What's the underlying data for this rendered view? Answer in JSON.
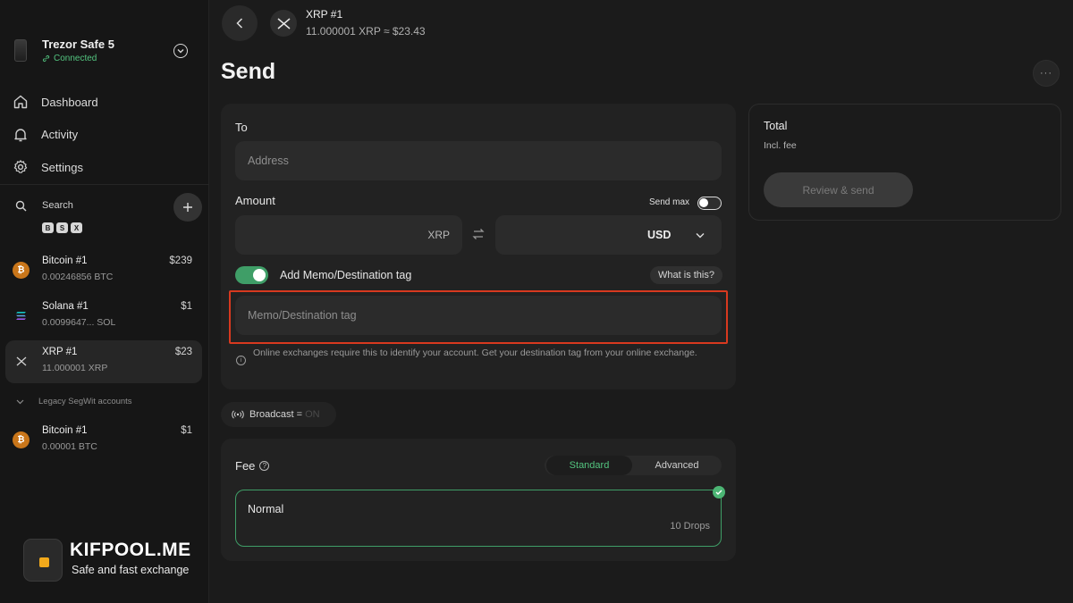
{
  "device": {
    "name": "Trezor Safe 5",
    "status": "Connected"
  },
  "nav": [
    {
      "label": "Dashboard",
      "icon": "home-icon"
    },
    {
      "label": "Activity",
      "icon": "bell-icon"
    },
    {
      "label": "Settings",
      "icon": "gear-icon"
    }
  ],
  "search": {
    "label": "Search"
  },
  "coin_filters": [
    "B",
    "S",
    "X"
  ],
  "accounts": [
    {
      "name": "Bitcoin #1",
      "balance": "0.00246856 BTC",
      "fiat": "$239",
      "icon": "bitcoin-icon",
      "color": "#f7931a"
    },
    {
      "name": "Solana #1",
      "balance": "0.0099647... SOL",
      "fiat": "$1",
      "icon": "solana-icon",
      "color": "#14f195"
    },
    {
      "name": "XRP #1",
      "balance": "11.000001 XRP",
      "fiat": "$23",
      "icon": "xrp-icon",
      "color": "#2e2e2e"
    }
  ],
  "legacy": {
    "label": "Legacy SegWit accounts",
    "accounts": [
      {
        "name": "Bitcoin #1",
        "balance": "0.00001 BTC",
        "fiat": "$1",
        "icon": "bitcoin-icon",
        "color": "#f7931a"
      }
    ]
  },
  "brand": {
    "title": "KIFPOOL.ME",
    "subtitle": "Safe and fast exchange"
  },
  "header": {
    "title": "XRP #1",
    "subtitle": "11.000001 XRP ≈ $23.43"
  },
  "page": {
    "title": "Send",
    "more_label": "···"
  },
  "form": {
    "to_label": "To",
    "address_placeholder": "Address",
    "amount_label": "Amount",
    "send_max_label": "Send max",
    "send_max_on": false,
    "amount_currency": "XRP",
    "fiat_currency": "USD",
    "memo_toggle_label": "Add Memo/Destination tag",
    "memo_toggle_on": true,
    "what_is_this": "What is this?",
    "memo_placeholder": "Memo/Destination tag",
    "memo_hint": "Online exchanges require this to identify your account. Get your destination tag from your online exchange."
  },
  "broadcast": {
    "label": "Broadcast",
    "separator": "=",
    "value": "ON"
  },
  "fee": {
    "label": "Fee",
    "tabs": [
      "Standard",
      "Advanced"
    ],
    "selected_tab": "Standard",
    "option_name": "Normal",
    "option_value": "10 Drops"
  },
  "total": {
    "label": "Total",
    "sub": "Incl. fee",
    "button": "Review & send"
  },
  "colors": {
    "accent": "#53c47f",
    "highlight": "#d8391f"
  }
}
